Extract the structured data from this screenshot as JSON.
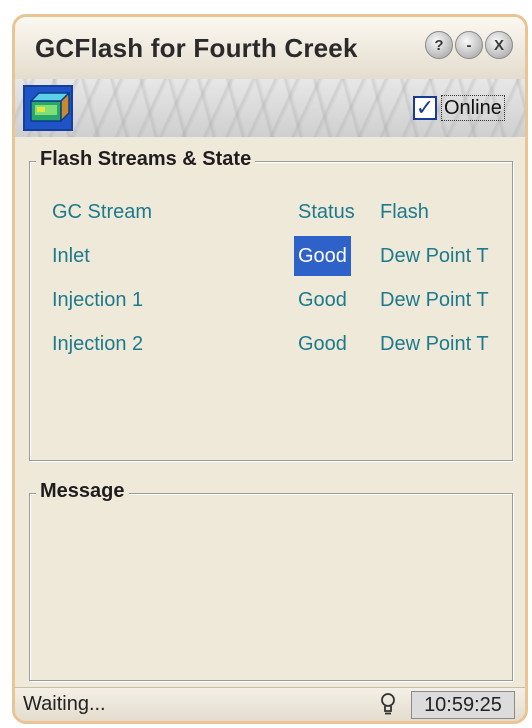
{
  "window": {
    "title": "GCFlash for Fourth Creek",
    "buttons": {
      "help": "?",
      "minimize": "-",
      "close": "X"
    }
  },
  "banner": {
    "online_label": "Online",
    "online_checked": true
  },
  "streams_group": {
    "legend": "Flash Streams & State",
    "headers": {
      "stream": "GC Stream",
      "status": "Status",
      "flash": "Flash"
    },
    "rows": [
      {
        "stream": "Inlet",
        "status": "Good",
        "flash": "Dew Point T",
        "selected": true
      },
      {
        "stream": "Injection 1",
        "status": "Good",
        "flash": "Dew Point T",
        "selected": false
      },
      {
        "stream": "Injection 2",
        "status": "Good",
        "flash": "Dew Point T",
        "selected": false
      }
    ]
  },
  "message_group": {
    "legend": "Message"
  },
  "statusbar": {
    "text": "Waiting...",
    "time": "10:59:25"
  },
  "colors": {
    "frame": "#e9c595",
    "selection": "#2e62c9",
    "link_text": "#1d7a8c"
  },
  "icons": {
    "app": "app-icon",
    "checkbox": "checkmark-icon",
    "status": "lightbulb-icon"
  }
}
